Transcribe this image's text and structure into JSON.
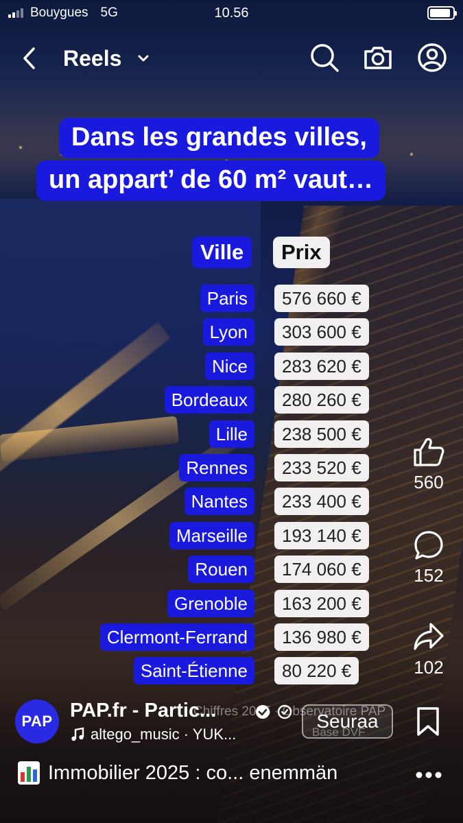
{
  "status_bar": {
    "carrier": "Bouygues",
    "network": "5G",
    "time": "10.56",
    "battery_level": 0.9
  },
  "nav": {
    "title": "Reels",
    "icons": [
      "back-arrow-icon",
      "chevron-down-icon",
      "search-icon",
      "camera-icon",
      "profile-icon"
    ]
  },
  "reel": {
    "headline_line1": "Dans les grandes villes,",
    "headline_line2": "un appart’ de 60 m² vaut…",
    "table": {
      "city_header": "Ville",
      "price_header": "Prix",
      "rows": [
        {
          "city": "Paris",
          "price": "576 660 €"
        },
        {
          "city": "Lyon",
          "price": "303 600 €"
        },
        {
          "city": "Nice",
          "price": "283 620 €"
        },
        {
          "city": "Bordeaux",
          "price": "280 260 €"
        },
        {
          "city": "Lille",
          "price": "238 500 €"
        },
        {
          "city": "Rennes",
          "price": "233 520 €"
        },
        {
          "city": "Nantes",
          "price": "233 400 €"
        },
        {
          "city": "Marseille",
          "price": "193 140 €"
        },
        {
          "city": "Rouen",
          "price": "174 060 €"
        },
        {
          "city": "Grenoble",
          "price": "163 200 €"
        },
        {
          "city": "Clermont-Ferrand",
          "price": "136 980 €"
        },
        {
          "city": "Saint-Étienne",
          "price": "80 220 €"
        }
      ]
    },
    "overlay_ghost_text": "Chiffres 2025 · Observatoire PAP",
    "overlay_ghost_text2": "Base DVF"
  },
  "actions": {
    "likes": "560",
    "comments": "152",
    "shares": "102"
  },
  "author": {
    "avatar_text": "PAP",
    "name": "PAP.fr - Partic...",
    "music": "altego_music · YUK...",
    "follow_label": "Seuraa"
  },
  "caption": {
    "text": "Immobilier 2025 : co... enemmän"
  },
  "colors": {
    "accent_blue": "#1a1adf",
    "price_bg": "#f1efef"
  }
}
